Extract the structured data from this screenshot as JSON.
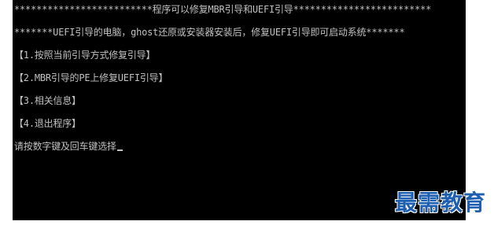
{
  "console": {
    "lines": [
      "*************************程序可以修复MBR引导和UEFI引导*************************",
      "*******UEFI引导的电脑，ghost还原或安装器安装后，修复UEFI引导即可启动系统*******",
      "【1.按照当前引导方式修复引导】",
      "【2.MBR引导的PE上修复UEFI引导】",
      "【3.相关信息】",
      "【4.退出程序】",
      "请按数字键及回车键选择"
    ],
    "colors": {
      "background": "#000000",
      "text": "#c0c0c0"
    }
  },
  "watermark": {
    "text": "最需教育",
    "color": "#1f5fb0"
  }
}
